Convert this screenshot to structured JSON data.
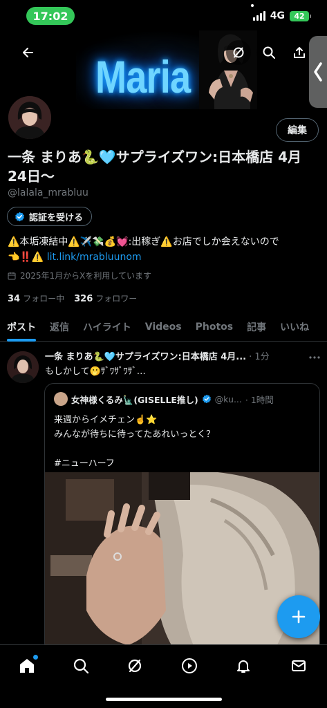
{
  "status_bar": {
    "time": "17:02",
    "network": "4G",
    "battery": "42"
  },
  "banner": {
    "title": "Maria"
  },
  "profile": {
    "edit_label": "編集",
    "name": "一条 まりあ🐍🩵サプライズワン:日本橋店 4月24日～",
    "handle": "@lalala_mrabluu",
    "verify_label": "認証を受ける",
    "bio_line1": "⚠️本垢凍結中⚠️✈️💸💰💓:出稼ぎ⚠️お店でしか会えないので",
    "bio_prefix": "👈‼️⚠️ ",
    "bio_link": "lit.link/mrabluunom",
    "joined": "2025年1月からXを利用しています",
    "following_count": "34",
    "following_label": "フォロー中",
    "followers_count": "326",
    "followers_label": "フォロワー"
  },
  "tabs": [
    {
      "label": "ポスト",
      "active": true
    },
    {
      "label": "返信"
    },
    {
      "label": "ハイライト"
    },
    {
      "label": "Videos"
    },
    {
      "label": "Photos"
    },
    {
      "label": "記事"
    },
    {
      "label": "いいね"
    }
  ],
  "post": {
    "author": "一条 まりあ🐍🩵サプライズワン:日本橋店 4月...",
    "time": "· 1分",
    "text": "もしかして🫢ｻﾞﾜｻﾞﾜｻﾞ…",
    "quote": {
      "author": "女神様くるみ🗽(GISELLE推し)",
      "handle": "@ku...",
      "time": "· 1時間",
      "line1": "来週からイメチェン☝️⭐️",
      "line2": "みんなが待ちに待ってたあれいっとく？",
      "line3": "#ニューハーフ"
    }
  },
  "colors": {
    "accent": "#1d9bf0",
    "background": "#000000",
    "muted": "#71767b"
  }
}
